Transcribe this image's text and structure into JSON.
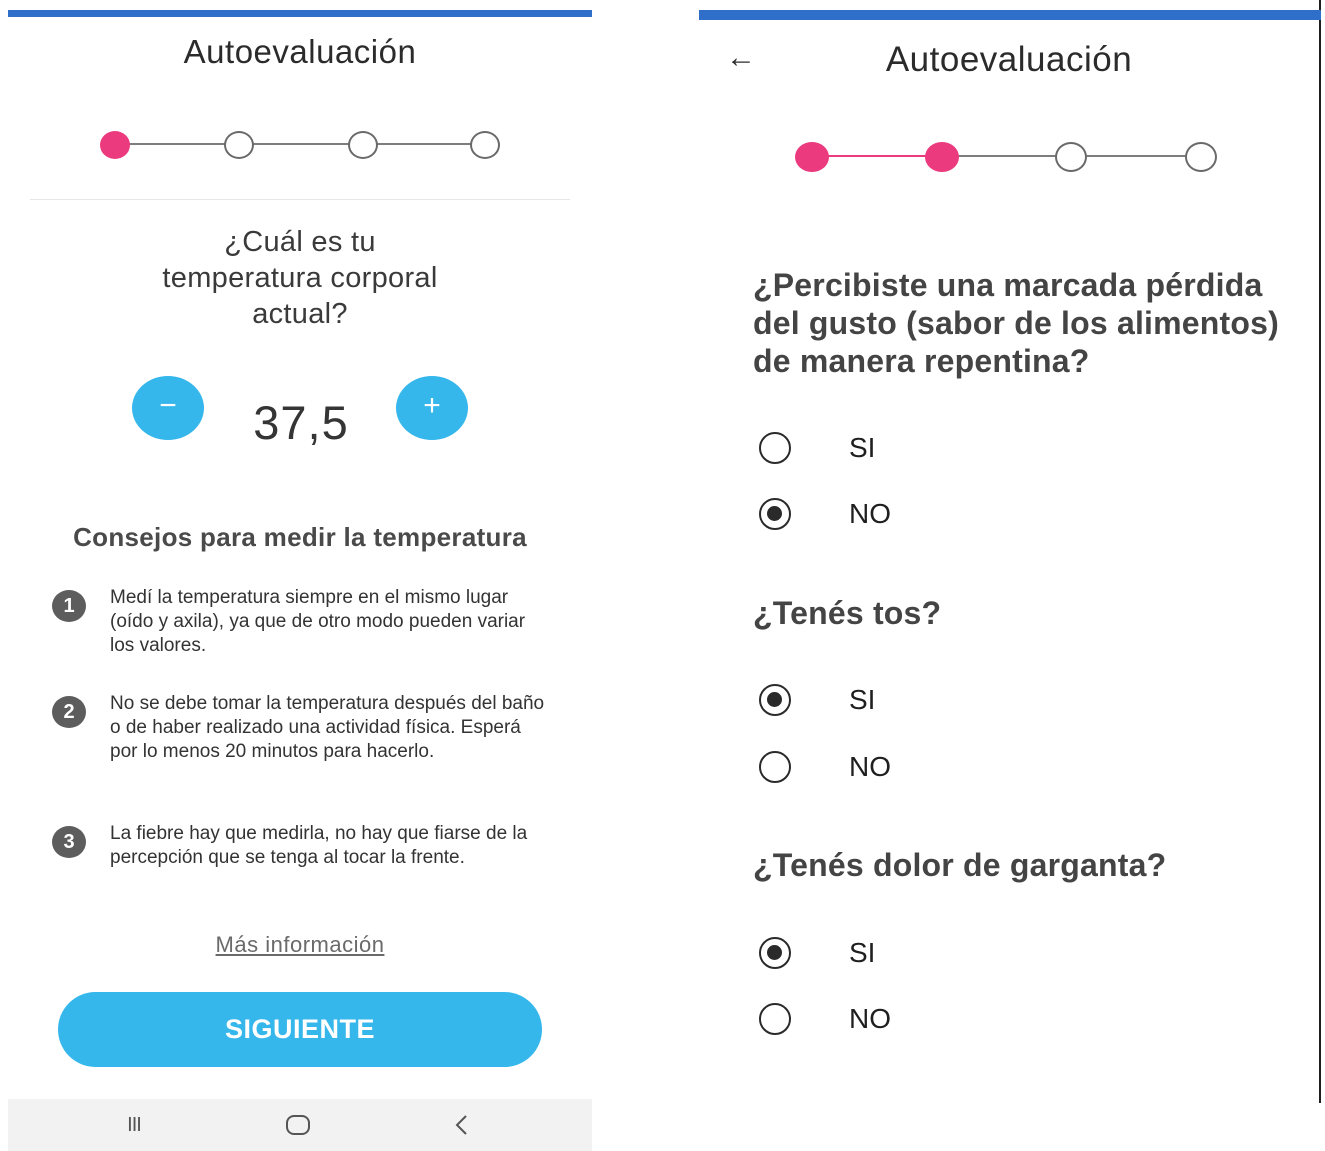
{
  "left_screen": {
    "title": "Autoevaluación",
    "stepper": {
      "total": 4,
      "current": 1
    },
    "question": "¿Cuál es tu temperatura corporal actual?",
    "decrement_label": "−",
    "temperature_value": "37,5",
    "increment_label": "+",
    "tips_title": "Consejos para medir la temperatura",
    "tips": [
      {
        "number": "1",
        "text": "Medí la temperatura siempre en el mismo lugar (oído y axila), ya que de otro modo pueden variar los valores."
      },
      {
        "number": "2",
        "text": "No se debe tomar la temperatura después del baño o de haber realizado una actividad física. Esperá por lo menos 20 minutos para hacerlo."
      },
      {
        "number": "3",
        "text": "La fiebre hay que medirla, no hay que fiarse de la percepción que se tenga al tocar la frente."
      }
    ],
    "more_info_link": "Más información",
    "next_button": "SIGUIENTE",
    "navbar": {
      "recents_icon": "III",
      "home_icon": "◯",
      "back_icon": "<"
    },
    "colors": {
      "accent": "#35b7ec",
      "step_active": "#ec3a7f",
      "topbar": "#2f6fca"
    }
  },
  "right_screen": {
    "back_icon": "←",
    "title": "Autoevaluación",
    "stepper": {
      "total": 4,
      "current": 2
    },
    "questions": [
      {
        "text": "¿Percibiste una marcada pérdida del gusto (sabor de los alimentos) de manera repentina?",
        "options": [
          {
            "label": "SI",
            "selected": false
          },
          {
            "label": "NO",
            "selected": true
          }
        ]
      },
      {
        "text": "¿Tenés tos?",
        "options": [
          {
            "label": "SI",
            "selected": true
          },
          {
            "label": "NO",
            "selected": false
          }
        ]
      },
      {
        "text": "¿Tenés dolor de garganta?",
        "options": [
          {
            "label": "SI",
            "selected": true
          },
          {
            "label": "NO",
            "selected": false
          }
        ]
      }
    ]
  }
}
